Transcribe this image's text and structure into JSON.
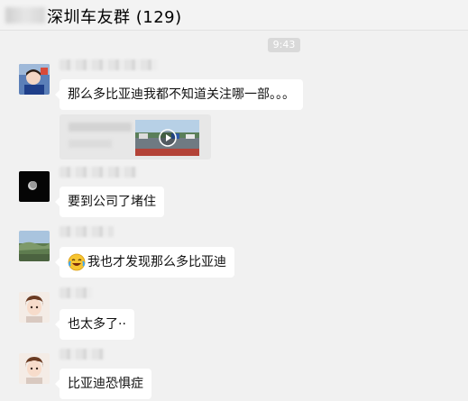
{
  "chat": {
    "title": "深圳车友群 (129)"
  },
  "time_divider": "9:43",
  "messages": [
    {
      "text": "那么多比亚迪我都不知道关注哪一部。。。"
    },
    {
      "type": "video"
    },
    {
      "text": "要到公司了堵住"
    },
    {
      "emoji": "laughing-crying-emoji",
      "text": "我也才发现那么多比亚迪"
    },
    {
      "text": "也太多了··"
    },
    {
      "text": "比亚迪恐惧症"
    }
  ],
  "colors": {
    "background": "#f1f1f1",
    "bubble": "#ffffff",
    "time_chip": "#d9d9d9"
  },
  "icons": [
    "play-icon",
    "laughing-crying-emoji"
  ]
}
